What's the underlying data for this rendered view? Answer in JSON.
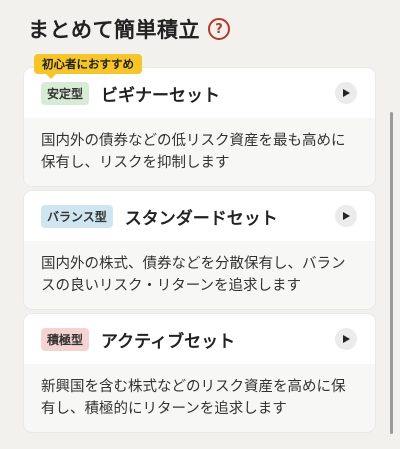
{
  "header": {
    "title": "まとめて簡単積立",
    "help_icon": "?"
  },
  "ribbon": {
    "label": "初心者におすすめ",
    "color": "#f5c52a"
  },
  "cards": [
    {
      "badge": "安定型",
      "badge_color": "#d7ecd4",
      "name": "ビギナーセット",
      "description": "国内外の債券などの低リスク資産を最も高めに保有し、リスクを抑制します"
    },
    {
      "badge": "バランス型",
      "badge_color": "#cfe6f0",
      "name": "スタンダードセット",
      "description": "国内外の株式、債券などを分散保有し、バランスの良いリスク・リターンを追求します"
    },
    {
      "badge": "積極型",
      "badge_color": "#f5d3d3",
      "name": "アクティブセット",
      "description": "新興国を含む株式などのリスク資産を高めに保有し、積極的にリターンを追求します"
    }
  ],
  "colors": {
    "background": "#f2f1ed",
    "accent": "#b33a2a"
  }
}
